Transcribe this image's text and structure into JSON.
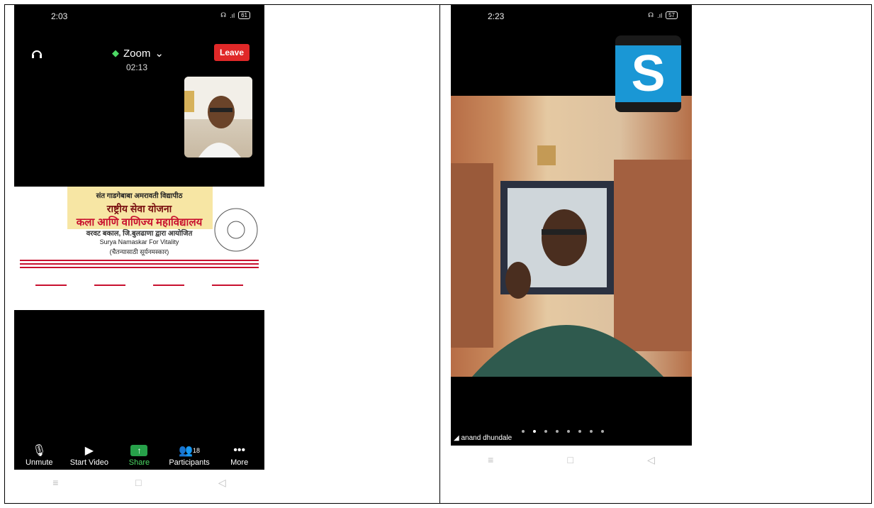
{
  "left_phone": {
    "time": "2:03",
    "battery": "61",
    "app_title": "Zoom",
    "leave_label": "Leave",
    "timer": "02:13",
    "banner": {
      "line1": "संत गाडगेबाबा अमरावती विद्यापीठ",
      "line2": "राष्ट्रीय सेवा योजना",
      "line3": "कला आणि वाणिज्य महाविद्यालय",
      "line4": "वरवट बकाल, जि.बुलढाणा द्वारा आयोजित",
      "line5": "Surya Namaskar For Vitality",
      "line6": "(चैतन्यासाठी सूर्यनमस्कार)"
    },
    "toolbar": {
      "unmute": "Unmute",
      "start_video": "Start Video",
      "share": "Share",
      "participants": "Participants",
      "participants_count": "18",
      "more": "More"
    }
  },
  "right_phone": {
    "time": "2:23",
    "battery": "57",
    "logo_letter": "S",
    "participant_name": "anand dhundale",
    "page_dots_count": 8,
    "active_dot": 2
  },
  "colors": {
    "leave": "#e02828",
    "share": "#27a14a",
    "logo": "#1a97d5"
  }
}
